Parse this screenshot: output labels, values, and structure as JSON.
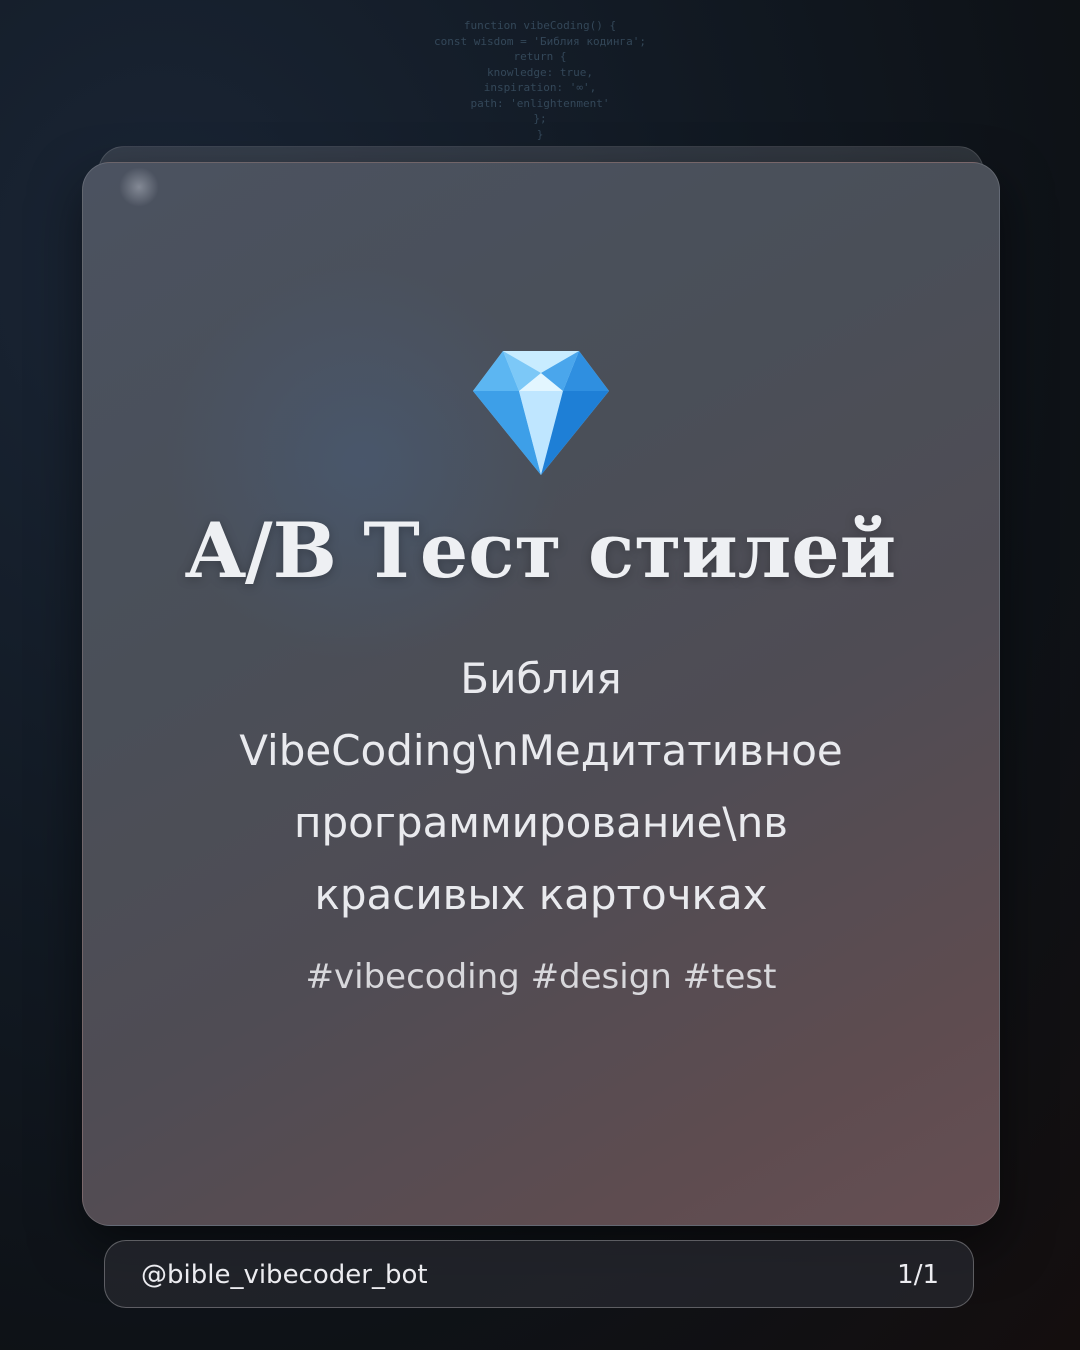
{
  "background_code": [
    "function vibeCoding() {",
    "const wisdom = 'Библия кодинга';",
    "return {",
    "knowledge: true,",
    "inspiration: '∞',",
    "path: 'enlightenment'",
    "};",
    "}"
  ],
  "card": {
    "icon": "gem-icon",
    "title": "A/B Тест стилей",
    "subtitle": "Библия VibeCoding\\nМедитативное программирование\\nв красивых карточках",
    "hashtags": "#vibecoding #design #test"
  },
  "footer": {
    "handle": "@bible_vibecoder_bot",
    "page_indicator": "1/1"
  },
  "colors": {
    "card_top": "#4b5260",
    "card_bottom": "#664f53",
    "text": "#eef0f3",
    "gem_light": "#a9dcff",
    "gem_dark": "#2f8fe0"
  }
}
